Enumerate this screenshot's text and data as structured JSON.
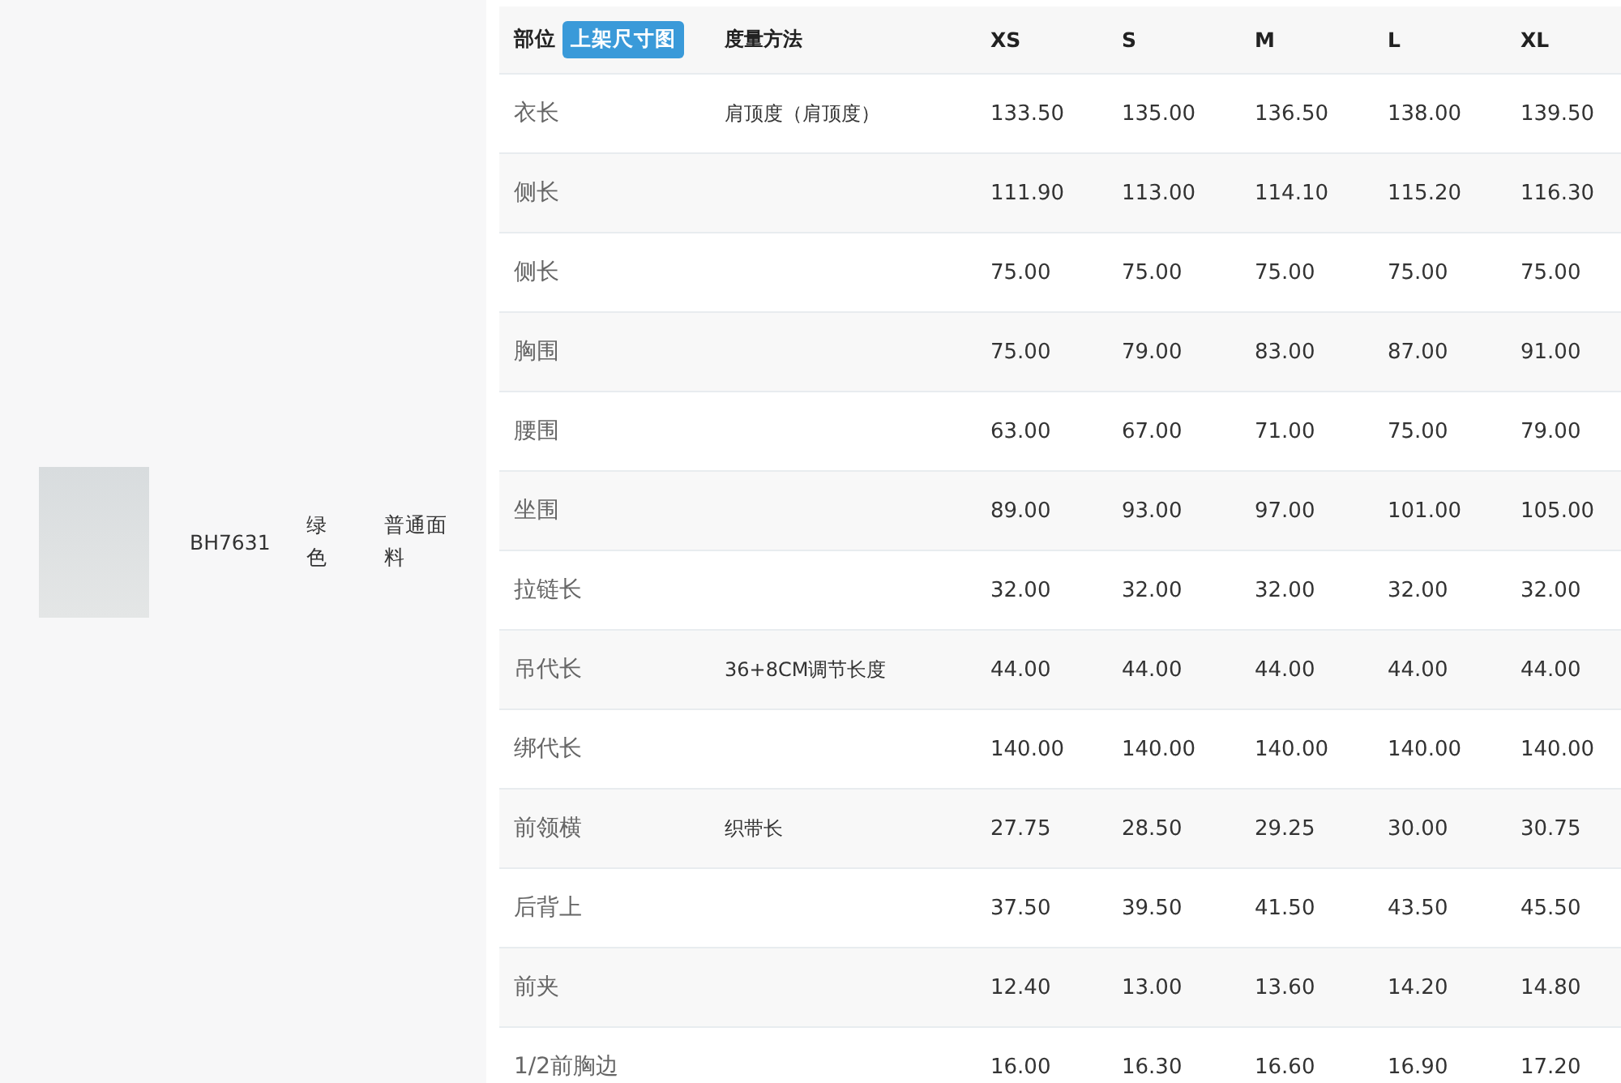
{
  "product": {
    "code": "BH7631",
    "colorway": "绿色",
    "fabric": "普通面料"
  },
  "table": {
    "columns": [
      "部位",
      "度量方法",
      "XS",
      "S",
      "M",
      "L",
      "XL"
    ],
    "badge": "上架尺寸图",
    "rows": [
      {
        "part": "衣长",
        "method": "肩顶度（肩顶度）",
        "values": [
          "133.50",
          "135.00",
          "136.50",
          "138.00",
          "139.50"
        ]
      },
      {
        "part": "侧长",
        "method": "",
        "values": [
          "111.90",
          "113.00",
          "114.10",
          "115.20",
          "116.30"
        ]
      },
      {
        "part": "侧长",
        "method": "",
        "values": [
          "75.00",
          "75.00",
          "75.00",
          "75.00",
          "75.00"
        ]
      },
      {
        "part": "胸围",
        "method": "",
        "values": [
          "75.00",
          "79.00",
          "83.00",
          "87.00",
          "91.00"
        ]
      },
      {
        "part": "腰围",
        "method": "",
        "values": [
          "63.00",
          "67.00",
          "71.00",
          "75.00",
          "79.00"
        ]
      },
      {
        "part": "坐围",
        "method": "",
        "values": [
          "89.00",
          "93.00",
          "97.00",
          "101.00",
          "105.00"
        ]
      },
      {
        "part": "拉链长",
        "method": "",
        "values": [
          "32.00",
          "32.00",
          "32.00",
          "32.00",
          "32.00"
        ]
      },
      {
        "part": "吊代长",
        "method": "36+8CM调节长度",
        "values": [
          "44.00",
          "44.00",
          "44.00",
          "44.00",
          "44.00"
        ]
      },
      {
        "part": "绑代长",
        "method": "",
        "values": [
          "140.00",
          "140.00",
          "140.00",
          "140.00",
          "140.00"
        ]
      },
      {
        "part": "前领横",
        "method": "织带长",
        "values": [
          "27.75",
          "28.50",
          "29.25",
          "30.00",
          "30.75"
        ]
      },
      {
        "part": "后背上",
        "method": "",
        "values": [
          "37.50",
          "39.50",
          "41.50",
          "43.50",
          "45.50"
        ]
      },
      {
        "part": "前夹",
        "method": "",
        "values": [
          "12.40",
          "13.00",
          "13.60",
          "14.20",
          "14.80"
        ]
      },
      {
        "part": "1/2前胸边",
        "method": "",
        "values": [
          "16.00",
          "16.30",
          "16.60",
          "16.90",
          "17.20"
        ]
      }
    ]
  }
}
